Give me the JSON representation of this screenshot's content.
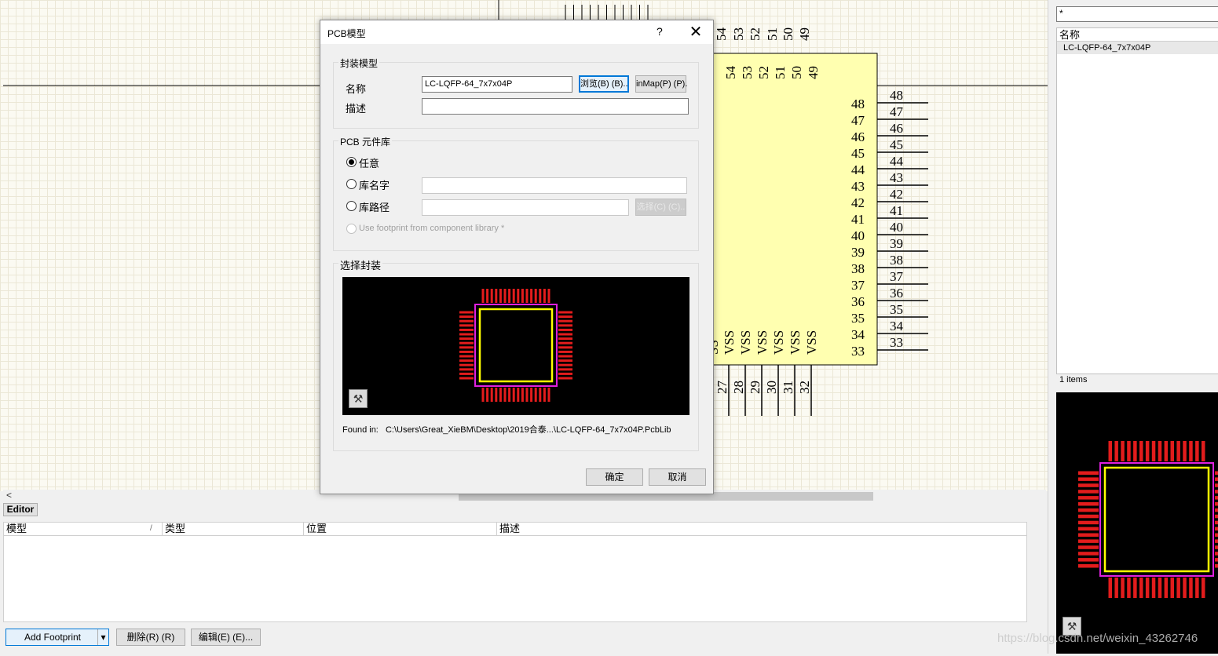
{
  "canvas": {
    "top_pins": [
      "54",
      "53",
      "52",
      "51",
      "50",
      "49"
    ],
    "top_inner_pins": [
      "54",
      "53",
      "52",
      "51",
      "50",
      "49"
    ],
    "right_inner_pins": [
      "48",
      "47",
      "46",
      "45",
      "44",
      "43",
      "42",
      "41",
      "40",
      "39",
      "38",
      "37",
      "36",
      "35",
      "34",
      "33"
    ],
    "right_outer_pins": [
      "48",
      "47",
      "46",
      "45",
      "44",
      "43",
      "42",
      "41",
      "40",
      "39",
      "38",
      "37",
      "36",
      "35",
      "34",
      "33"
    ],
    "bottom_labels": [
      "VSS",
      "VSS",
      "VSS",
      "VSS",
      "VSS",
      "VSS"
    ],
    "bottom_pins": [
      "27",
      "28",
      "29",
      "30",
      "31",
      "32"
    ],
    "colors": {
      "component_fill": "#ffffb0",
      "canvas_bg": "#fbfaf2"
    }
  },
  "scroll": {
    "left_arrow": "<"
  },
  "editor": {
    "tab_label": "Editor",
    "columns": [
      "模型",
      "类型",
      "位置",
      "描述"
    ],
    "sort_indicator": "/"
  },
  "buttons": {
    "add_footprint": "Add Footprint",
    "dropdown_arrow": "▾",
    "delete": "删除(R) (R)",
    "edit": "编辑(E) (E)..."
  },
  "right_panel": {
    "filter_value": "*",
    "list_header": "名称",
    "items": [
      "LC-LQFP-64_7x7x04P"
    ],
    "count": "1 items"
  },
  "dialog": {
    "title": "PCB模型",
    "help": "?",
    "close": "✕",
    "footprint_group": "封装模型",
    "name_label": "名称",
    "name_value": "LC-LQFP-64_7x7x04P",
    "browse_button": "浏览(B) (B)..",
    "pinmap_button": "inMap(P) (P).",
    "desc_label": "描述",
    "desc_value": "",
    "library_group": "PCB 元件库",
    "radio_any": "任意",
    "radio_libname": "库名字",
    "radio_libpath": "库路径",
    "select_button": "选择(C) (C)..",
    "use_footprint": "Use footprint from component library *",
    "select_group": "选择封装",
    "found_in_label": "Found in:",
    "found_in_path": "C:\\Users\\Great_XieBM\\Desktop\\2019合泰...\\LC-LQFP-64_7x7x04P.PcbLib",
    "ok": "确定",
    "cancel": "取消"
  },
  "watermark": "https://blog.csdn.net/weixin_43262746"
}
